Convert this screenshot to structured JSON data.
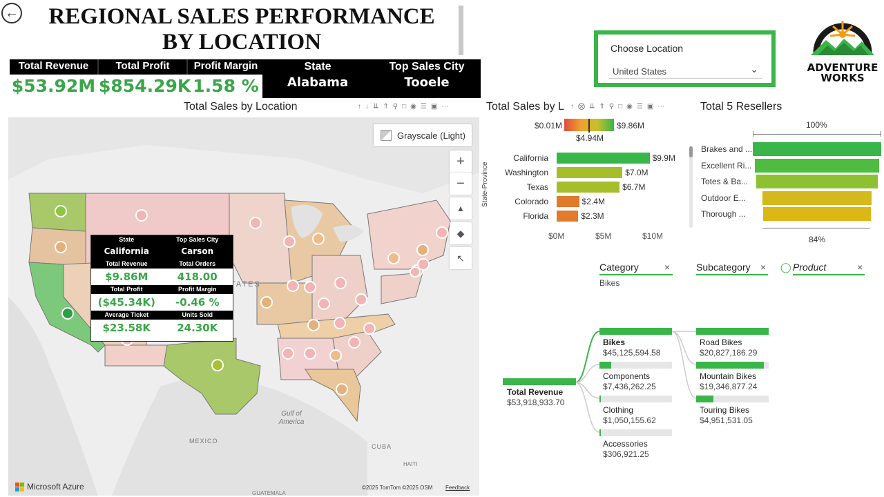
{
  "header": {
    "back_icon": "back-arrow-icon",
    "title_line1": "REGIONAL SALES PERFORMANCE",
    "title_line2": "BY LOCATION"
  },
  "kpis": {
    "total_revenue_label": "Total Revenue",
    "total_revenue_value": "$53.92M",
    "total_profit_label": "Total Profit",
    "total_profit_value": "$854.29K",
    "profit_margin_label": "Profit Margin",
    "profit_margin_value": "1.58 %",
    "state_label": "State",
    "state_value": "Alabama",
    "top_city_label": "Top Sales City",
    "top_city_value": "Tooele"
  },
  "map_section": {
    "title": "Total Sales by Location",
    "style_button": "Grayscale (Light)",
    "zoom_in": "+",
    "zoom_out": "−",
    "footer_brand": "Microsoft Azure",
    "attribution": "©2025 TomTom  ©2025 OSM",
    "feedback": "Feedback",
    "place_gulf": "Gulf of America",
    "place_mexico": "MEXICO",
    "place_cuba": "CUBA",
    "place_haiti": "HAITI",
    "place_guatemala": "GUATEMALA",
    "place_states": "TATES",
    "tooltip": {
      "state_label": "State",
      "state_value": "California",
      "city_label": "Top Sales City",
      "city_value": "Carson",
      "revenue_label": "Total Revenue",
      "revenue_value": "$9.86M",
      "orders_label": "Total Orders",
      "orders_value": "418.00",
      "profit_label": "Total Profit",
      "profit_value": "($45.34K)",
      "margin_label": "Profit Margin",
      "margin_value": "-0.46 %",
      "ticket_label": "Average Ticket",
      "ticket_value": "$23.58K",
      "units_label": "Units Sold",
      "units_value": "24.30K"
    }
  },
  "chooser": {
    "label": "Choose Location",
    "value": "United States"
  },
  "logo": {
    "line1": "ADVENTURE",
    "line2": "WORKS"
  },
  "bar_section": {
    "title": "Total Sales by L",
    "legend_min": "$0.01M",
    "legend_max": "$9.86M",
    "legend_mid": "$4.94M",
    "y_axis_title": "State-Province"
  },
  "chart_data": {
    "type": "bar",
    "orientation": "horizontal",
    "categories": [
      "California",
      "Washington",
      "Texas",
      "Colorado",
      "Florida"
    ],
    "values": [
      9.9,
      7.0,
      6.7,
      2.4,
      2.3
    ],
    "value_labels": [
      "$9.9M",
      "$7.0M",
      "$6.7M",
      "$2.4M",
      "$2.3M"
    ],
    "colors": [
      "#3ab54a",
      "#a5be2a",
      "#a5be2a",
      "#e07a2c",
      "#e07a2c"
    ],
    "xticks": [
      "$0M",
      "$5M",
      "$10M"
    ],
    "xlim": [
      0,
      10
    ],
    "title": "Total Sales by L",
    "ylabel": "State-Province"
  },
  "resellers": {
    "title": "Total 5 Resellers",
    "top_label": "100%",
    "bottom_label": "84%",
    "items": [
      {
        "name": "Brakes and ...",
        "value": 100,
        "color": "#3ab54a"
      },
      {
        "name": "Excellent Ri...",
        "value": 97,
        "color": "#4fbb3f"
      },
      {
        "name": "Totes & Ba...",
        "value": 95,
        "color": "#8cc232"
      },
      {
        "name": "Outdoor E...",
        "value": 85,
        "color": "#d4b91b"
      },
      {
        "name": "Thorough ...",
        "value": 84,
        "color": "#dcb715"
      }
    ]
  },
  "slicers": {
    "category_title": "Category",
    "category_value": "Bikes",
    "subcategory_title": "Subcategory",
    "product_title": "Product",
    "close_icon": "×"
  },
  "decomposition": {
    "root_name": "Total Revenue",
    "root_value": "$53,918,933.70",
    "categories": [
      {
        "name": "Bikes",
        "value": "$45,125,594.58",
        "fraction": 1.0
      },
      {
        "name": "Components",
        "value": "$7,436,262.25",
        "fraction": 0.165
      },
      {
        "name": "Clothing",
        "value": "$1,050,155.62",
        "fraction": 0.023
      },
      {
        "name": "Accessories",
        "value": "$306,921.25",
        "fraction": 0.007
      }
    ],
    "subcategories": [
      {
        "name": "Road Bikes",
        "value": "$20,827,186.29",
        "fraction": 1.0
      },
      {
        "name": "Mountain Bikes",
        "value": "$19,346,877.24",
        "fraction": 0.93
      },
      {
        "name": "Touring Bikes",
        "value": "$4,951,531.05",
        "fraction": 0.24
      }
    ]
  }
}
